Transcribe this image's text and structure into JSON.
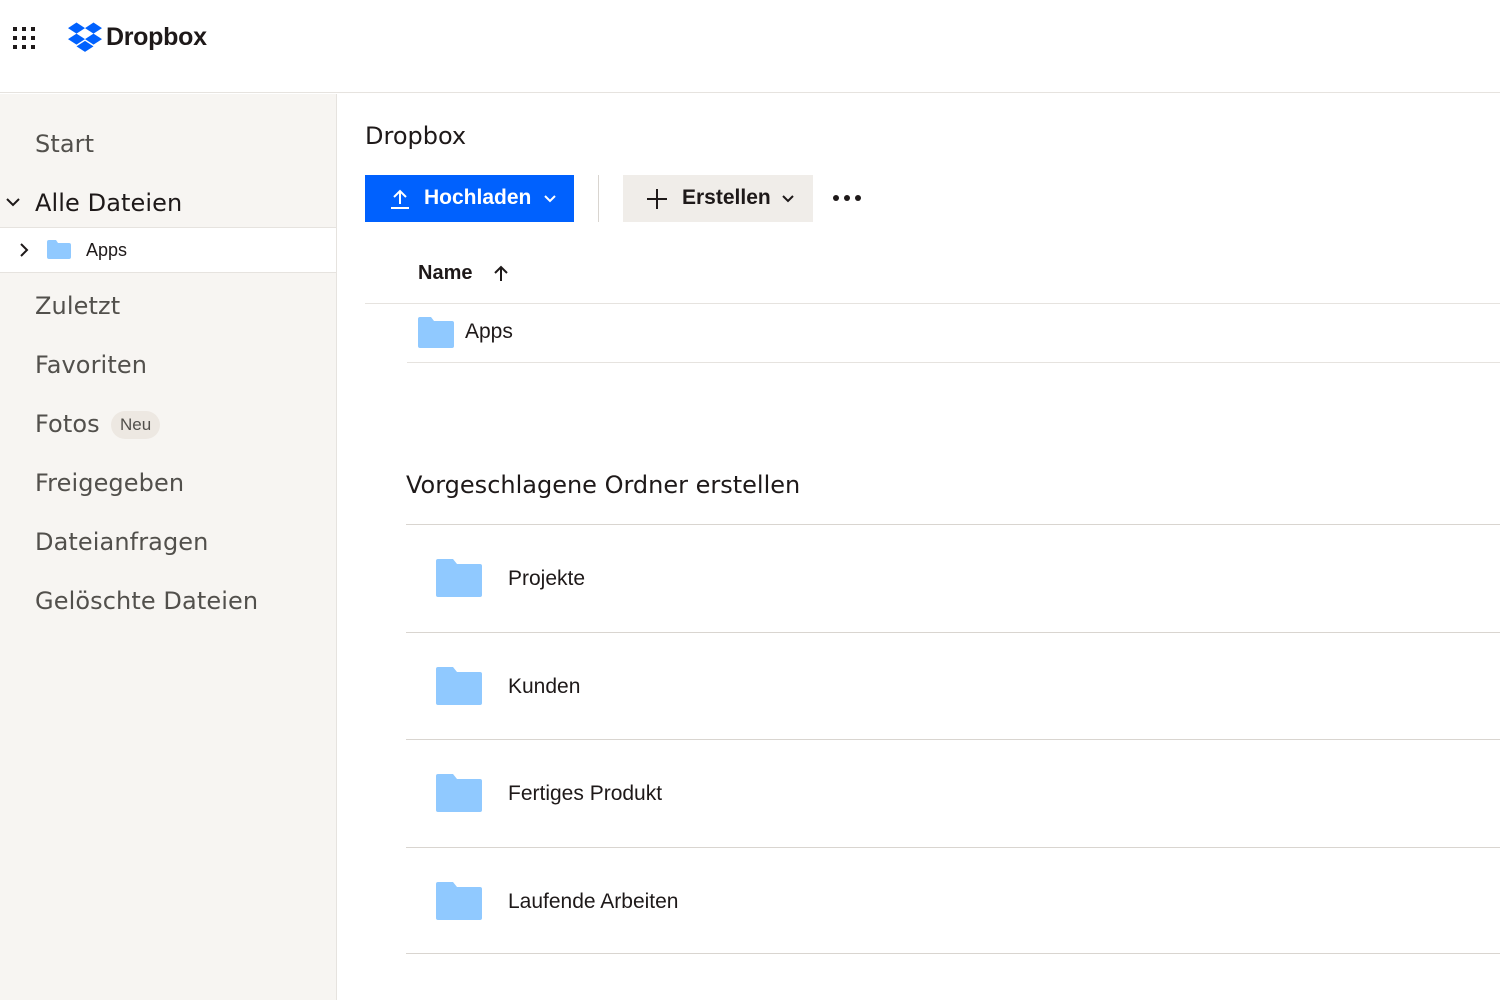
{
  "brand": {
    "name": "Dropbox",
    "color": "#0061fe"
  },
  "sidebar": {
    "items": [
      {
        "label": "Start"
      },
      {
        "label": "Alle Dateien",
        "expanded": true
      },
      {
        "label": "Zuletzt"
      },
      {
        "label": "Favoriten"
      },
      {
        "label": "Fotos",
        "badge": "Neu"
      },
      {
        "label": "Freigegeben"
      },
      {
        "label": "Dateianfragen"
      },
      {
        "label": "Gelöschte Dateien"
      }
    ],
    "tree_child": {
      "label": "Apps"
    }
  },
  "main": {
    "title": "Dropbox",
    "toolbar": {
      "upload_label": "Hochladen",
      "create_label": "Erstellen"
    },
    "list": {
      "column_name": "Name",
      "rows": [
        {
          "name": "Apps"
        }
      ]
    },
    "suggested": {
      "title": "Vorgeschlagene Ordner erstellen",
      "folders": [
        {
          "name": "Projekte"
        },
        {
          "name": "Kunden"
        },
        {
          "name": "Fertiges Produkt"
        },
        {
          "name": "Laufende Arbeiten"
        }
      ]
    }
  },
  "icons": {
    "apps_grid": "apps-grid-icon",
    "folder_color": "#90c9ff",
    "upload": "upload-icon",
    "plus": "plus-icon",
    "more": "more-horizontal-icon",
    "sort": "arrow-up-icon"
  }
}
